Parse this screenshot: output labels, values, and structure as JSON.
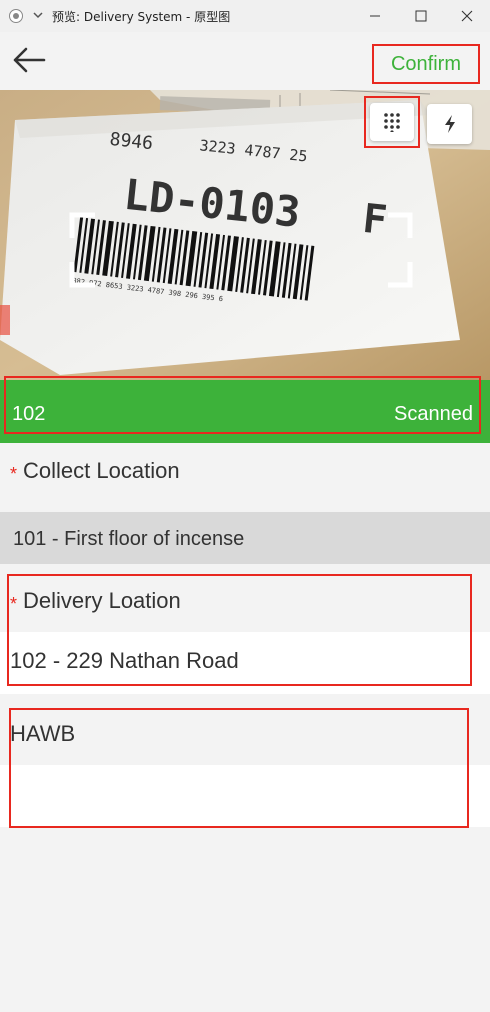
{
  "window": {
    "title": "预览: Delivery System - 原型图"
  },
  "header": {
    "confirm_label": "Confirm"
  },
  "camera": {
    "label_text_1": "8946",
    "label_text_2": "3223 4787 25",
    "label_code": "LD-0103",
    "label_letter": "F",
    "barcode_digits": "882 972 8653 3223 4787 398 296 395 6"
  },
  "scan": {
    "code": "102",
    "status": "Scanned"
  },
  "form": {
    "collect_label": "Collect Location",
    "collect_value": "101 - First floor of incense",
    "delivery_label": "Delivery Loation",
    "delivery_value": "102 - 229 Nathan Road",
    "hawb_label": "HAWB",
    "hawb_value": ""
  },
  "colors": {
    "accent_green": "#3db23a",
    "highlight_red": "#e8281f"
  },
  "icons": {
    "back": "arrow-left-icon",
    "keypad": "keypad-icon",
    "flash": "flash-icon"
  }
}
